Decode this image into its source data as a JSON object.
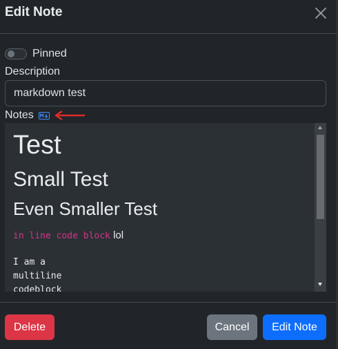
{
  "modal": {
    "title": "Edit Note"
  },
  "pinned": {
    "label": "Pinned",
    "checked": false
  },
  "description": {
    "label": "Description",
    "value": "markdown test"
  },
  "notes": {
    "label": "Notes",
    "icon": "markdown-icon",
    "heading1": "Test",
    "heading2": "Small Test",
    "heading3": "Even Smaller Test",
    "inline_code": "in line code block",
    "inline_text": "lol",
    "code_lines": [
      "I am a",
      "multiline",
      "codeblock"
    ]
  },
  "footer": {
    "delete_label": "Delete",
    "cancel_label": "Cancel",
    "save_label": "Edit Note"
  },
  "colors": {
    "background": "#212529",
    "danger": "#dc3545",
    "secondary": "#6c757d",
    "primary": "#0d6efd",
    "code_pink": "#d63384",
    "annotation_arrow": "#dc2b2b",
    "markdown_icon": "#3d8bfd"
  }
}
